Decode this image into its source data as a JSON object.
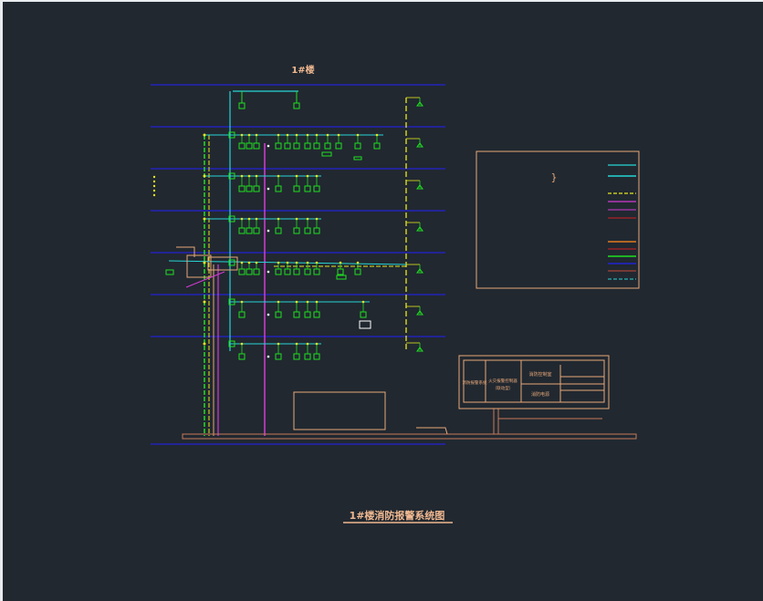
{
  "drawing": {
    "building_label": "1#楼",
    "title": "1#楼消防报警系统图",
    "legend_brace": "}",
    "table": {
      "col1": "消防报警系统",
      "col2_line1": "火灾报警控制器",
      "col2_line2": "（联动型）",
      "col3_row1": "消防控制室",
      "col3_row2": "消防电源"
    }
  },
  "colors": {
    "background": "#212830",
    "floor_line": "#2323d2",
    "device": "#1fe01f",
    "riser_cyan": "#27d6d6",
    "riser_magenta": "#d43ad4",
    "dashed_yellow": "#e6e61e",
    "outline": "#e8a878",
    "dark_outline": "#c87a5a"
  }
}
